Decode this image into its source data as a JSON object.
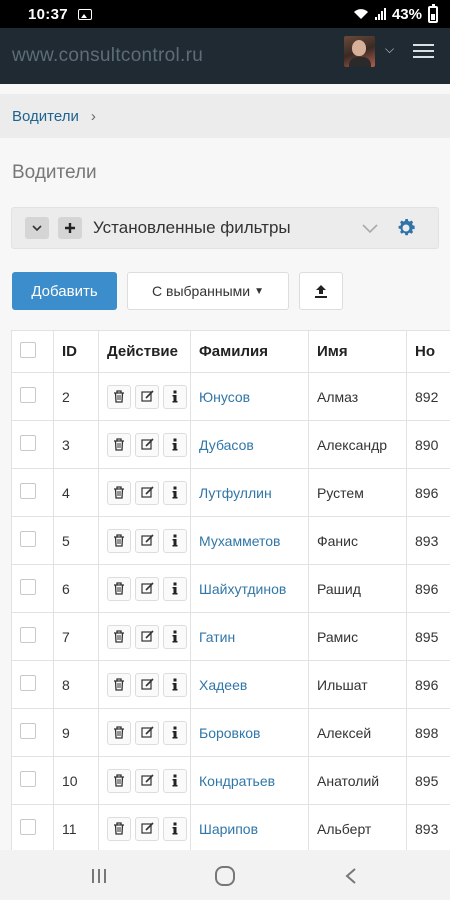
{
  "status_bar": {
    "time": "10:37",
    "battery": "43%"
  },
  "app": {
    "brand": "www.consultcontrol.ru"
  },
  "breadcrumb": {
    "item": "Водители",
    "separator": "›"
  },
  "page": {
    "title": "Водители"
  },
  "filters": {
    "label": "Установленные фильтры"
  },
  "toolbar": {
    "add_label": "Добавить",
    "selected_label": "С выбранными"
  },
  "table": {
    "headers": [
      "ID",
      "Действие",
      "Фамилия",
      "Имя",
      "Но"
    ],
    "rows": [
      {
        "id": "2",
        "surname": "Юнусов",
        "name": "Алмаз",
        "phone": "892"
      },
      {
        "id": "3",
        "surname": "Дубасов",
        "name": "Александр",
        "phone": "890"
      },
      {
        "id": "4",
        "surname": "Лутфуллин",
        "name": "Рустем",
        "phone": "896"
      },
      {
        "id": "5",
        "surname": "Мухамметов",
        "name": "Фанис",
        "phone": "893"
      },
      {
        "id": "6",
        "surname": "Шайхутдинов",
        "name": "Рашид",
        "phone": "896"
      },
      {
        "id": "7",
        "surname": "Гатин",
        "name": "Рамис",
        "phone": "895"
      },
      {
        "id": "8",
        "surname": "Хадеев",
        "name": "Ильшат",
        "phone": "896"
      },
      {
        "id": "9",
        "surname": "Боровков",
        "name": "Алексей",
        "phone": "898"
      },
      {
        "id": "10",
        "surname": "Кондратьев",
        "name": "Анатолий",
        "phone": "895"
      },
      {
        "id": "11",
        "surname": "Шарипов",
        "name": "Альберт",
        "phone": "893"
      }
    ]
  },
  "colors": {
    "header_bg": "#1f2a32",
    "primary": "#3c8dcb",
    "link": "#3176a8"
  },
  "icons": {
    "filter_settings": "gear-icon",
    "upload": "upload-icon",
    "row_delete": "trash-icon",
    "row_edit": "edit-icon",
    "row_info": "info-icon"
  }
}
